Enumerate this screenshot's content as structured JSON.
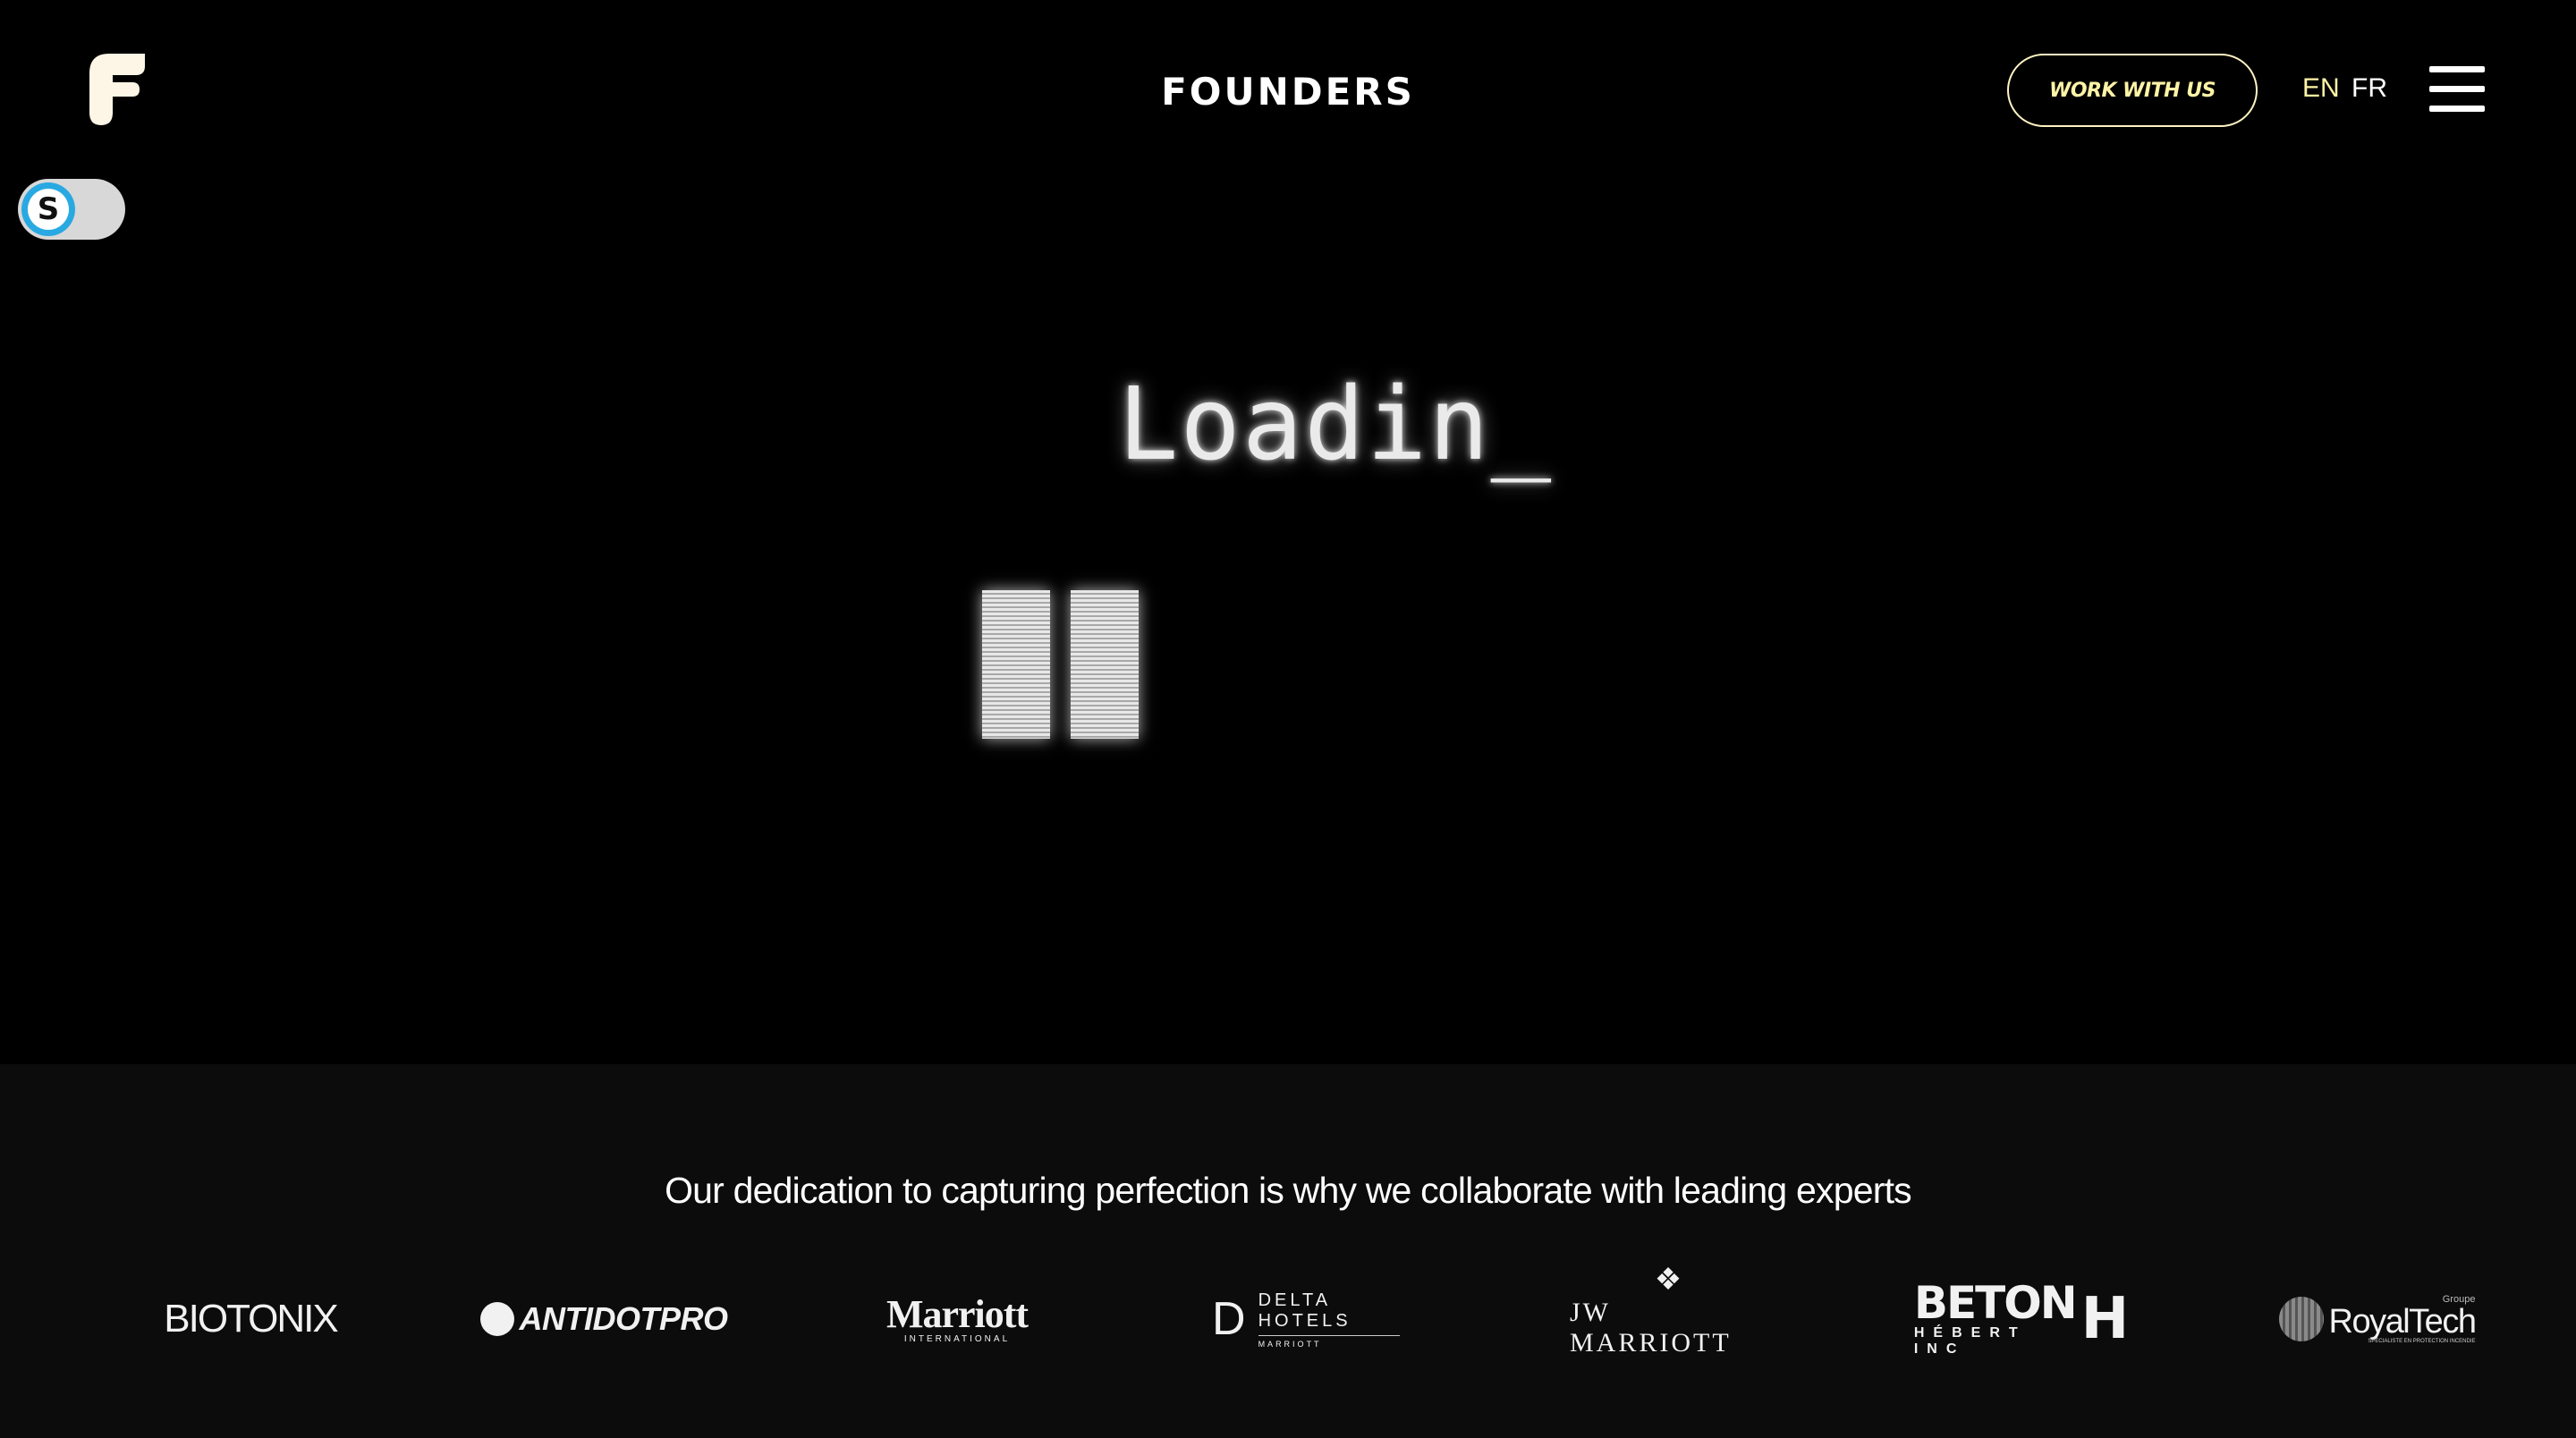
{
  "header": {
    "brand": "FOUNDERS",
    "cta_label": "WORK WITH US",
    "lang_en": "EN",
    "lang_fr": "FR"
  },
  "toggle": {
    "knob_letter": "S"
  },
  "loader": {
    "text": "Loadin_"
  },
  "partners": {
    "heading": "Our dedication to capturing perfection is why we collaborate with leading experts",
    "logos": {
      "biotonix": "BIOTONIX",
      "antidotpro": "ANTIDOTPRO",
      "marriott": "Marriott",
      "marriott_sub": "INTERNATIONAL",
      "delta": "DELTA HOTELS",
      "delta_sub": "MARRIOTT",
      "jw": "JW MARRIOTT",
      "beton": "BETON",
      "beton_sub": "HÉBERT INC",
      "royal_pre": "Groupe",
      "royal": "RoyalTech",
      "royal_sub": "SPÉCIALISTE EN PROTECTION INCENDIE"
    }
  },
  "colors": {
    "background": "#000000",
    "partners_background": "#0c0c0c",
    "accent": "#fff3a6"
  },
  "icons": [
    "founders-logo-icon",
    "hamburger-menu-icon",
    "pause-icon"
  ]
}
